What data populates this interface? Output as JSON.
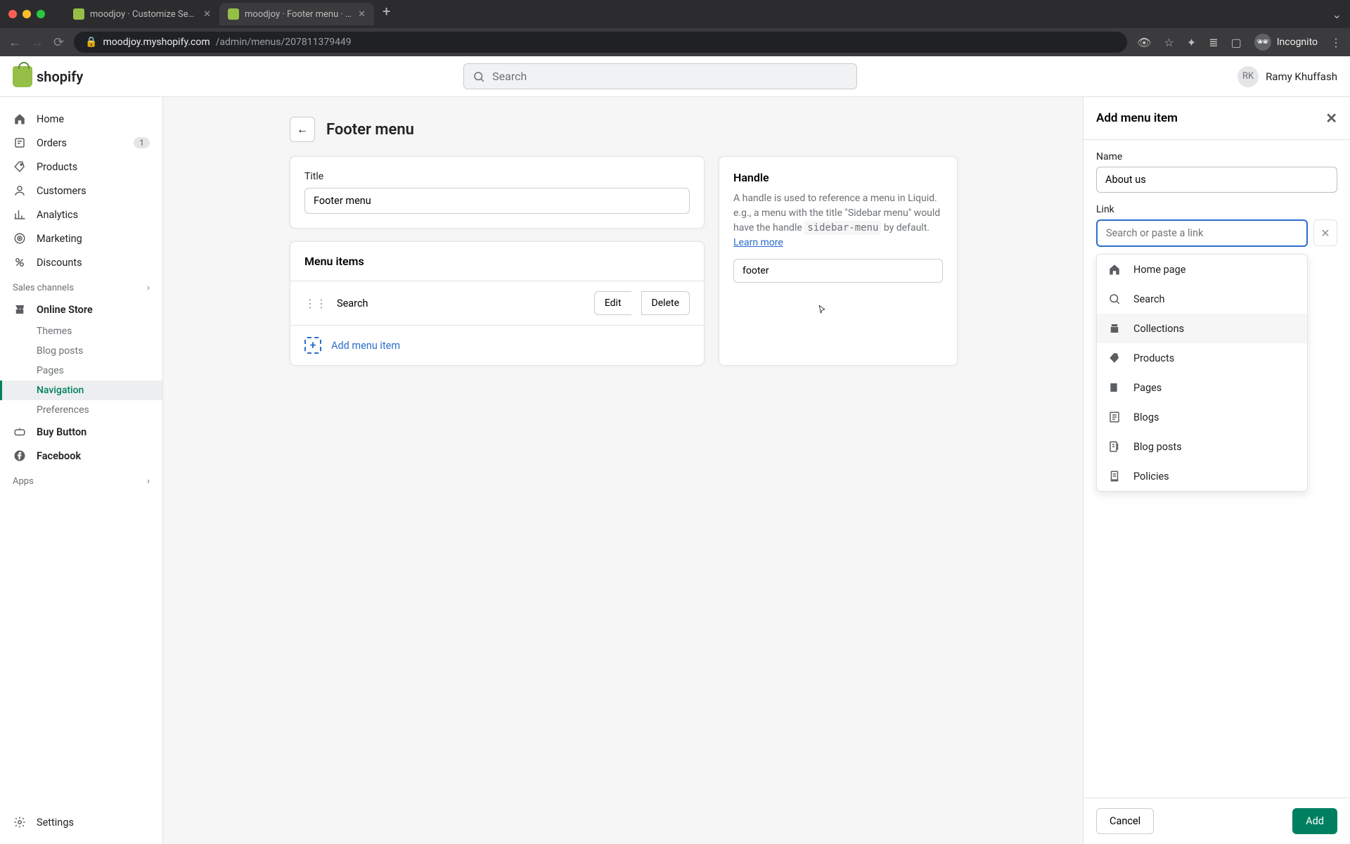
{
  "browser": {
    "tabs": [
      {
        "title": "moodjoy · Customize Sense · S"
      },
      {
        "title": "moodjoy · Footer menu · Shopi"
      }
    ],
    "url_host": "moodjoy.myshopify.com",
    "url_path": "/admin/menus/207811379449",
    "incognito_label": "Incognito"
  },
  "topbar": {
    "logo_text": "shopify",
    "search_placeholder": "Search",
    "user_initials": "RK",
    "user_name": "Ramy Khuffash"
  },
  "sidebar": {
    "items": [
      {
        "label": "Home"
      },
      {
        "label": "Orders",
        "badge": "1"
      },
      {
        "label": "Products"
      },
      {
        "label": "Customers"
      },
      {
        "label": "Analytics"
      },
      {
        "label": "Marketing"
      },
      {
        "label": "Discounts"
      }
    ],
    "sales_channels_label": "Sales channels",
    "online_store": {
      "label": "Online Store",
      "sub": [
        {
          "label": "Themes"
        },
        {
          "label": "Blog posts"
        },
        {
          "label": "Pages"
        },
        {
          "label": "Navigation"
        },
        {
          "label": "Preferences"
        }
      ]
    },
    "channels": [
      {
        "label": "Buy Button"
      },
      {
        "label": "Facebook"
      }
    ],
    "apps_label": "Apps",
    "settings_label": "Settings"
  },
  "page": {
    "title": "Footer menu",
    "title_field_label": "Title",
    "title_value": "Footer menu",
    "menu_items_header": "Menu items",
    "rows": [
      {
        "label": "Search",
        "edit": "Edit",
        "delete": "Delete"
      }
    ],
    "add_label": "Add menu item",
    "handle": {
      "title": "Handle",
      "text_prefix": "A handle is used to reference a menu in Liquid. e.g., a menu with the title \"Sidebar menu\" would have the handle ",
      "code": "sidebar-menu",
      "text_suffix": " by default. ",
      "learn_more": "Learn more",
      "value": "footer"
    }
  },
  "panel": {
    "title": "Add menu item",
    "name_label": "Name",
    "name_value": "About us",
    "link_label": "Link",
    "link_placeholder": "Search or paste a link",
    "options": [
      {
        "label": "Home page"
      },
      {
        "label": "Search"
      },
      {
        "label": "Collections"
      },
      {
        "label": "Products"
      },
      {
        "label": "Pages"
      },
      {
        "label": "Blogs"
      },
      {
        "label": "Blog posts"
      },
      {
        "label": "Policies"
      }
    ],
    "cancel": "Cancel",
    "add": "Add"
  }
}
